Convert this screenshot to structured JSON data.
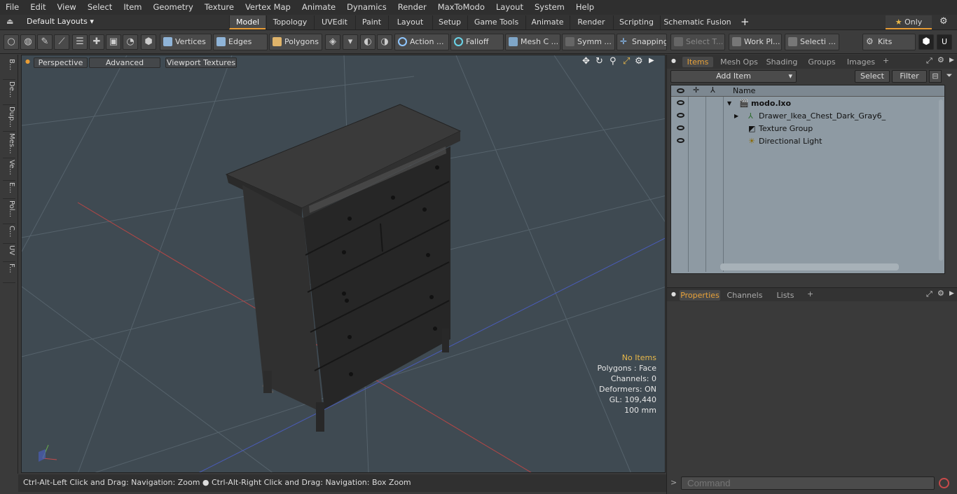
{
  "menu": [
    "File",
    "Edit",
    "View",
    "Select",
    "Item",
    "Geometry",
    "Texture",
    "Vertex Map",
    "Animate",
    "Dynamics",
    "Render",
    "MaxToModo",
    "Layout",
    "System",
    "Help"
  ],
  "layout": {
    "preset": "Default Layouts",
    "tabs": [
      "Model",
      "Topology",
      "UVEdit",
      "Paint",
      "Layout",
      "Setup",
      "Game Tools",
      "Animate",
      "Render",
      "Scripting",
      "Schematic Fusion"
    ],
    "only_label": "Only"
  },
  "toolbar": {
    "vertices": "Vertices",
    "edges": "Edges",
    "polygons": "Polygons",
    "action": "Action ...",
    "falloff": "Falloff",
    "mesh": "Mesh C ...",
    "symm": "Symm ...",
    "snapping": "Snapping",
    "select_t": "Select T...",
    "work": "Work Pl...",
    "selecti": "Selecti ...",
    "kits": "Kits"
  },
  "left_tabs": [
    "B...",
    "De...",
    "Dup...",
    "Mes...",
    "Ve...",
    "E...",
    "Pol...",
    "C...",
    "UV",
    "F..."
  ],
  "viewport": {
    "view": "Perspective",
    "advanced": "Advanced",
    "textures": "Viewport Textures",
    "stats": {
      "items": "No Items",
      "polygons": "Polygons : Face",
      "channels": "Channels: 0",
      "deformers": "Deformers: ON",
      "gl": "GL: 109,440",
      "scale": "100 mm"
    }
  },
  "status": "Ctrl-Alt-Left Click and Drag: Navigation: Zoom ● Ctrl-Alt-Right Click and Drag: Navigation: Box Zoom",
  "items_panel": {
    "tabs": [
      "Items",
      "Mesh Ops",
      "Shading",
      "Groups",
      "Images"
    ],
    "add_item": "Add Item",
    "select": "Select",
    "filter": "Filter",
    "col_name": "Name",
    "rows": [
      "modo.lxo",
      "Drawer_Ikea_Chest_Dark_Gray6_",
      "Texture Group",
      "Directional Light"
    ]
  },
  "props_panel": {
    "tabs": [
      "Properties",
      "Channels",
      "Lists"
    ]
  },
  "command_placeholder": "Command",
  "colors": {
    "accent": "#e89c35",
    "viewport_bg": "#3f4a52",
    "list_bg": "#8e9aa3"
  }
}
